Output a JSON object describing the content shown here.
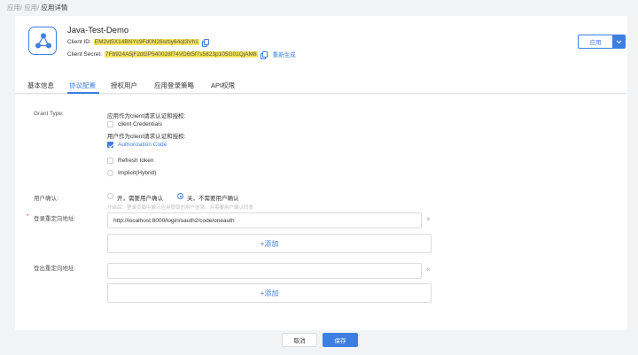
{
  "breadcrumb": {
    "item1": "应用/",
    "item2": "应用/",
    "current": "应用详情"
  },
  "app": {
    "name": "Java-Test-Demo",
    "client_id_label": "Client ID:",
    "client_id": "EM2vt5X14BNYc9Fd0N26srby64qt3Vh1",
    "client_secret_label": "Client Secret:",
    "client_secret": "7Fb924A5jF2dGP540028f74VD6t5f7s5823p105G01QjAM8",
    "regenerate": "重新生成",
    "app_button": "应用",
    "icon": "app-logo-icon",
    "accent_color": "#3d7fe0",
    "highlight_color": "#f5e25a"
  },
  "tabs": [
    {
      "label": "基本信息"
    },
    {
      "label": "协议配置"
    },
    {
      "label": "授权用户"
    },
    {
      "label": "应用登录策略"
    },
    {
      "label": "API权限"
    }
  ],
  "active_tab": "协议配置",
  "grant": {
    "label": "Grant Type:",
    "section1": "应用作为client请求认证和授权:",
    "client_credentials": "client Credentials",
    "section2": "用户作为client请求认证和授权:",
    "authorization_code": "Authorization Code",
    "refresh_token": "Refresh token",
    "implicit": "Implicit(Hybrid)"
  },
  "consent": {
    "label": "用户确认:",
    "option_on": "开，需要用户确认",
    "option_off": "关，不需要用户确认",
    "selected": "关，不需要用户确认",
    "hint": "开启后，登录页面中展示应用获取的用户信息，并需要用户确认同意"
  },
  "login_redirect": {
    "required_mark": "*",
    "label": "登录重定向地址:",
    "value": "http://localhost:8000/login/oauth2/code/oneauth",
    "clear": "×",
    "add_button": "+添加"
  },
  "logout_redirect": {
    "label": "登出重定向地址:",
    "value": "",
    "clear": "×",
    "add_button": "+添加"
  },
  "footer": {
    "cancel": "取消",
    "save": "保存"
  }
}
